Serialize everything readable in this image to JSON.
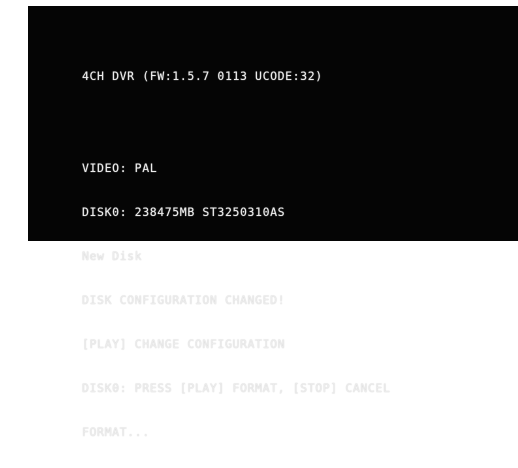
{
  "header": {
    "title": "4CH DVR (FW:1.5.7 0113 UCODE:32)"
  },
  "status_lines": [
    "VIDEO: PAL",
    "DISK0: 238475MB ST3250310AS",
    "New Disk",
    "DISK CONFIGURATION CHANGED!",
    "[PLAY] CHANGE CONFIGURATION",
    "DISK0: PRESS [PLAY] FORMAT, [STOP] CANCEL",
    "FORMAT..."
  ],
  "colors": {
    "screen_background": "#050505",
    "text": "#ececec"
  }
}
